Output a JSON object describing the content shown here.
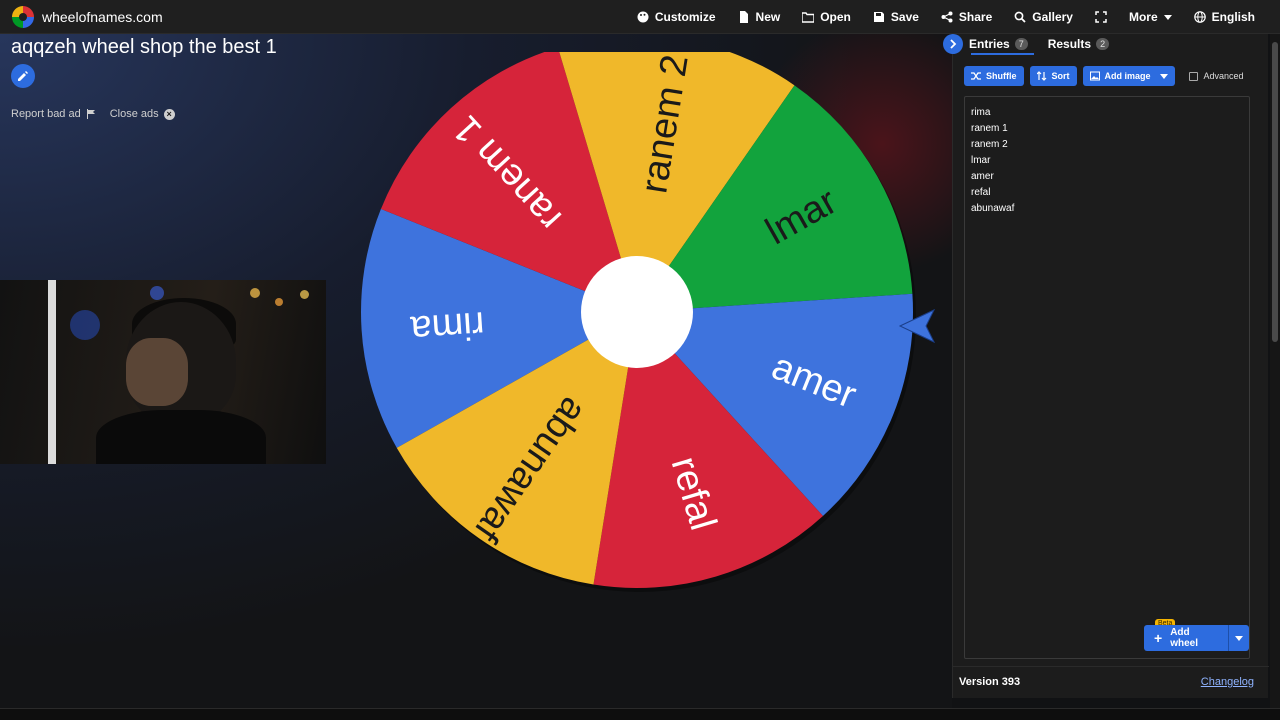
{
  "site": {
    "name": "wheelofnames.com"
  },
  "menu": [
    {
      "label": "Customize",
      "icon": "palette-icon"
    },
    {
      "label": "New",
      "icon": "new-file-icon"
    },
    {
      "label": "Open",
      "icon": "folder-icon"
    },
    {
      "label": "Save",
      "icon": "save-icon"
    },
    {
      "label": "Share",
      "icon": "share-icon"
    },
    {
      "label": "Gallery",
      "icon": "search-icon"
    },
    {
      "label": "",
      "icon": "fullscreen-icon"
    },
    {
      "label": "More",
      "icon": "chevron-down-icon"
    },
    {
      "label": "English",
      "icon": "globe-icon"
    }
  ],
  "wheel": {
    "title": "aqqzeh wheel shop the best 1",
    "segments": [
      {
        "label": "rima",
        "color": "#3E73DD"
      },
      {
        "label": "ranem 1",
        "color": "#D6243A"
      },
      {
        "label": "ranem 2",
        "color": "#F0B82A"
      },
      {
        "label": "lmar",
        "color": "#12A33D"
      },
      {
        "label": "amer",
        "color": "#3E73DD"
      },
      {
        "label": "refal",
        "color": "#D6243A"
      },
      {
        "label": "abunawaf",
        "color": "#F0B82A"
      }
    ],
    "center_color": "#FFFFFF",
    "pointer_color": "#3E73DD"
  },
  "ads": {
    "report_label": "Report bad ad",
    "close_label": "Close ads"
  },
  "panel": {
    "tabs": [
      {
        "label": "Entries",
        "count": "7"
      },
      {
        "label": "Results",
        "count": "2"
      }
    ],
    "toolbar": {
      "shuffle": "Shuffle",
      "sort": "Sort",
      "add_image": "Add image",
      "advanced": "Advanced"
    },
    "entries": [
      "rima",
      "ranem 1",
      "ranem 2",
      "lmar",
      "amer",
      "refal",
      "abunawaf"
    ],
    "add_wheel": {
      "label": "Add wheel",
      "badge": "Beta"
    },
    "version": "Version 393",
    "changelog": "Changelog"
  },
  "colors": {
    "accent": "#2D6CDF",
    "topbar": "#1F1F1F",
    "panel": "#1C1C1C"
  }
}
